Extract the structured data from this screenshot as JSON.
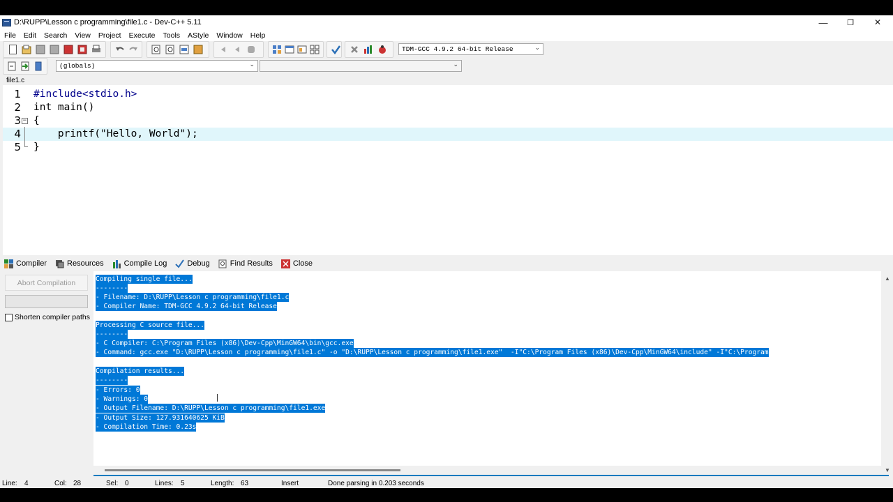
{
  "window": {
    "title": "D:\\RUPP\\Lesson c programming\\file1.c - Dev-C++ 5.11",
    "minimize": "—",
    "restore": "❐",
    "close": "✕"
  },
  "menu": [
    "File",
    "Edit",
    "Search",
    "View",
    "Project",
    "Execute",
    "Tools",
    "AStyle",
    "Window",
    "Help"
  ],
  "toolbar": {
    "compiler_select": "TDM-GCC 4.9.2 64-bit Release",
    "scope_select": "(globals)",
    "member_select": ""
  },
  "editor": {
    "tab": "file1.c",
    "lines": [
      {
        "num": "1",
        "text": "#include<stdio.h>"
      },
      {
        "num": "2",
        "text": "int main()"
      },
      {
        "num": "3",
        "text": "{"
      },
      {
        "num": "4",
        "text": "    printf(\"Hello, World\");"
      },
      {
        "num": "5",
        "text": "}"
      }
    ],
    "active_line": 4
  },
  "bottom_tabs": [
    "Compiler",
    "Resources",
    "Compile Log",
    "Debug",
    "Find Results",
    "Close"
  ],
  "selected_bottom_tab": "Compile Log",
  "compile_panel": {
    "abort_button": "Abort Compilation",
    "shorten_paths": "Shorten compiler paths"
  },
  "log": [
    "Compiling single file...",
    "--------",
    "- Filename: D:\\RUPP\\Lesson c programming\\file1.c",
    "- Compiler Name: TDM-GCC 4.9.2 64-bit Release",
    "",
    "Processing C source file...",
    "--------",
    "- C Compiler: C:\\Program Files (x86)\\Dev-Cpp\\MinGW64\\bin\\gcc.exe",
    "- Command: gcc.exe \"D:\\RUPP\\Lesson c programming\\file1.c\" -o \"D:\\RUPP\\Lesson c programming\\file1.exe\"  -I\"C:\\Program Files (x86)\\Dev-Cpp\\MinGW64\\include\" -I\"C:\\Program",
    "",
    "Compilation results...",
    "--------",
    "- Errors: 0",
    "- Warnings: 0",
    "- Output Filename: D:\\RUPP\\Lesson c programming\\file1.exe",
    "- Output Size: 127.931640625 KiB",
    "- Compilation Time: 0.23s"
  ],
  "status": {
    "line_label": "Line:",
    "line": "4",
    "col_label": "Col:",
    "col": "28",
    "sel_label": "Sel:",
    "sel": "0",
    "lines_label": "Lines:",
    "lines": "5",
    "length_label": "Length:",
    "length": "63",
    "mode": "Insert",
    "message": "Done parsing in 0.203 seconds"
  },
  "colors": {
    "selection": "#0078d7",
    "active_line": "#e0f6fb",
    "preprocessor": "#00008b"
  }
}
